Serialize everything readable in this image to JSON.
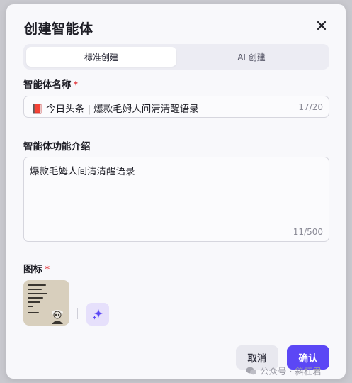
{
  "dialog": {
    "title": "创建智能体",
    "close_icon": "close-icon"
  },
  "tabs": [
    {
      "label": "标准创建",
      "active": true
    },
    {
      "label": "AI 创建",
      "active": false
    }
  ],
  "name_field": {
    "label": "智能体名称",
    "required_mark": "*",
    "emoji": "📕",
    "value": "今日头条 | 爆款毛姆人间清清醒语录",
    "counter": "17/20"
  },
  "desc_field": {
    "label": "智能体功能介绍",
    "value": "爆款毛姆人间清清醒语录",
    "counter": "11/500"
  },
  "icon_field": {
    "label": "图标",
    "required_mark": "*",
    "ai_icon": "sparkle-icon"
  },
  "actions": {
    "cancel_label": "取消",
    "confirm_label": "确认"
  },
  "watermark": {
    "text": "公众号 · 斜杠君",
    "icon": "wechat-icon"
  },
  "colors": {
    "primary": "#5b47f5",
    "required": "#e5484d",
    "ai_button_bg": "#e6e0fb"
  }
}
